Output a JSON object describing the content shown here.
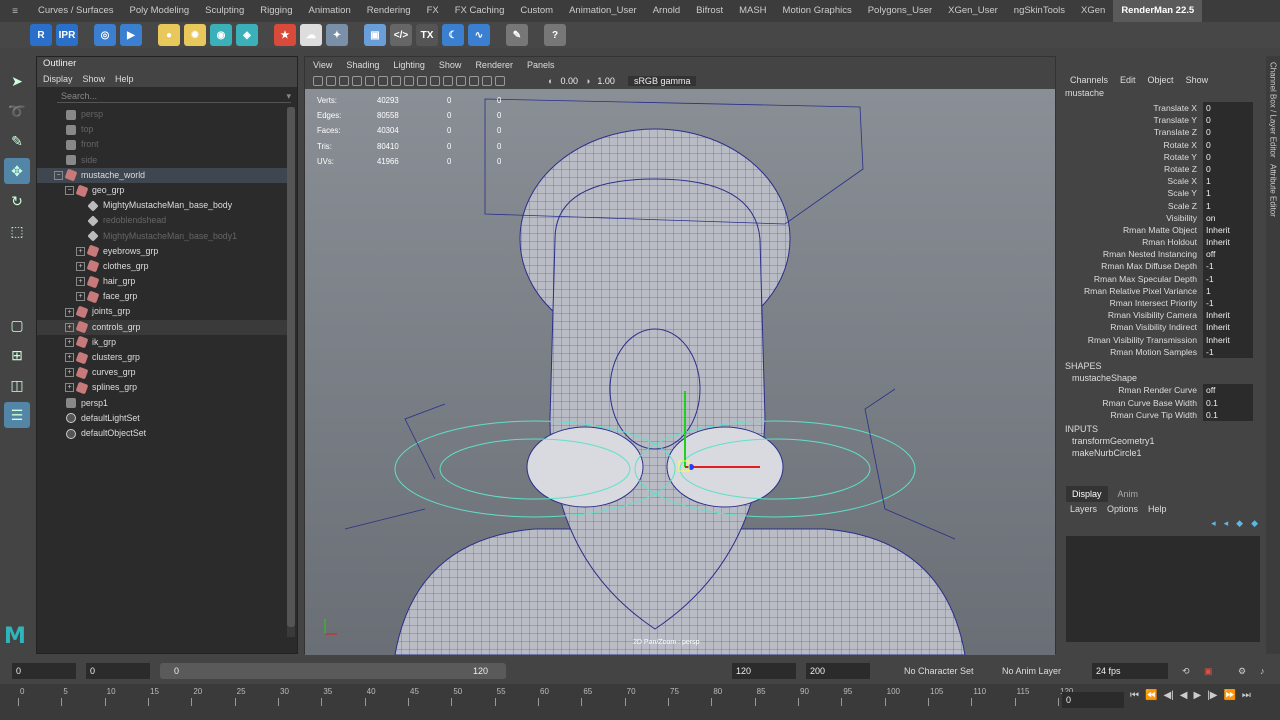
{
  "shelf": {
    "tabs": [
      "Curves / Surfaces",
      "Poly Modeling",
      "Sculpting",
      "Rigging",
      "Animation",
      "Rendering",
      "FX",
      "FX Caching",
      "Custom",
      "Animation_User",
      "Arnold",
      "Bifrost",
      "MASH",
      "Motion Graphics",
      "Polygons_User",
      "XGen_User",
      "ngSkinTools",
      "XGen",
      "RenderMan 22.5"
    ],
    "active_tab": "RenderMan 22.5",
    "icons": [
      {
        "name": "renderman-render-icon",
        "glyph": "R",
        "color": "#2a6fc9"
      },
      {
        "name": "renderman-ipr-icon",
        "glyph": "IPR",
        "color": "#2a6fc9"
      },
      {
        "name": "clapper-icon",
        "glyph": "◎",
        "color": "#3a7fd0"
      },
      {
        "name": "render-view-icon",
        "glyph": "▶",
        "color": "#3a7fd0"
      },
      {
        "name": "env-light-icon",
        "glyph": "●",
        "color": "#e8c85a"
      },
      {
        "name": "sun-light-icon",
        "glyph": "✹",
        "color": "#e8c85a"
      },
      {
        "name": "dome-light-icon",
        "glyph": "◉",
        "color": "#3bb0b8"
      },
      {
        "name": "light-filter-icon",
        "glyph": "◈",
        "color": "#3bb0b8"
      },
      {
        "name": "pixar-material-icon",
        "glyph": "★",
        "color": "#d84a3a"
      },
      {
        "name": "cloud-icon",
        "glyph": "☁",
        "color": "#dddddd"
      },
      {
        "name": "gear-star-icon",
        "glyph": "✦",
        "color": "#7a8fa8"
      },
      {
        "name": "cube-icon",
        "glyph": "▣",
        "color": "#6a9ed8"
      },
      {
        "name": "code-icon",
        "glyph": "</>",
        "color": "#666666"
      },
      {
        "name": "txmanager-icon",
        "glyph": "TX",
        "color": "#555555"
      },
      {
        "name": "moon-icon",
        "glyph": "☾",
        "color": "#3a7fd0"
      },
      {
        "name": "waveform-icon",
        "glyph": "∿",
        "color": "#3a7fd0"
      },
      {
        "name": "tools-icon",
        "glyph": "✎",
        "color": "#777777"
      },
      {
        "name": "help-icon",
        "glyph": "?",
        "color": "#777777"
      }
    ]
  },
  "outliner": {
    "title": "Outliner",
    "menu": [
      "Display",
      "Show",
      "Help"
    ],
    "search_placeholder": "Search...",
    "items": [
      {
        "label": "persp",
        "indent": 1,
        "icon": "cam",
        "dim": true
      },
      {
        "label": "top",
        "indent": 1,
        "icon": "cam",
        "dim": true
      },
      {
        "label": "front",
        "indent": 1,
        "icon": "cam",
        "dim": true
      },
      {
        "label": "side",
        "indent": 1,
        "icon": "cam",
        "dim": true
      },
      {
        "label": "mustache_world",
        "indent": 1,
        "icon": "grp",
        "exp": "−",
        "sel": true
      },
      {
        "label": "geo_grp",
        "indent": 2,
        "icon": "grp",
        "exp": "−"
      },
      {
        "label": "MightyMustacheMan_base_body",
        "indent": 3,
        "icon": "mesh"
      },
      {
        "label": "redoblendshead",
        "indent": 3,
        "icon": "mesh",
        "dim": true
      },
      {
        "label": "MightyMustacheMan_base_body1",
        "indent": 3,
        "icon": "mesh",
        "dim": true
      },
      {
        "label": "eyebrows_grp",
        "indent": 3,
        "icon": "grp",
        "exp": "+"
      },
      {
        "label": "clothes_grp",
        "indent": 3,
        "icon": "grp",
        "exp": "+"
      },
      {
        "label": "hair_grp",
        "indent": 3,
        "icon": "grp",
        "exp": "+"
      },
      {
        "label": "face_grp",
        "indent": 3,
        "icon": "grp",
        "exp": "+"
      },
      {
        "label": "joints_grp",
        "indent": 2,
        "icon": "grp",
        "exp": "+"
      },
      {
        "label": "controls_grp",
        "indent": 2,
        "icon": "grp",
        "exp": "+",
        "hl": true
      },
      {
        "label": "ik_grp",
        "indent": 2,
        "icon": "grp",
        "exp": "+"
      },
      {
        "label": "clusters_grp",
        "indent": 2,
        "icon": "grp",
        "exp": "+"
      },
      {
        "label": "curves_grp",
        "indent": 2,
        "icon": "grp",
        "exp": "+"
      },
      {
        "label": "splines_grp",
        "indent": 2,
        "icon": "grp",
        "exp": "+"
      },
      {
        "label": "persp1",
        "indent": 1,
        "icon": "cam"
      },
      {
        "label": "defaultLightSet",
        "indent": 1,
        "icon": "set"
      },
      {
        "label": "defaultObjectSet",
        "indent": 1,
        "icon": "set"
      }
    ]
  },
  "viewport": {
    "menu": [
      "View",
      "Shading",
      "Lighting",
      "Show",
      "Renderer",
      "Panels"
    ],
    "exposure": "0.00",
    "gamma": "1.00",
    "color_space": "sRGB gamma",
    "hud": [
      {
        "label": "Verts:",
        "v1": "40293",
        "v2": "0",
        "v3": "0"
      },
      {
        "label": "Edges:",
        "v1": "80558",
        "v2": "0",
        "v3": "0"
      },
      {
        "label": "Faces:",
        "v1": "40304",
        "v2": "0",
        "v3": "0"
      },
      {
        "label": "Tris:",
        "v1": "80410",
        "v2": "0",
        "v3": "0"
      },
      {
        "label": "UVs:",
        "v1": "41966",
        "v2": "0",
        "v3": "0"
      }
    ],
    "camera_label": "2D Pan/Zoom : persp"
  },
  "channel_box": {
    "menu": [
      "Channels",
      "Edit",
      "Object",
      "Show"
    ],
    "node": "mustache",
    "attributes": [
      {
        "name": "Translate X",
        "value": "0"
      },
      {
        "name": "Translate Y",
        "value": "0"
      },
      {
        "name": "Translate Z",
        "value": "0"
      },
      {
        "name": "Rotate X",
        "value": "0"
      },
      {
        "name": "Rotate Y",
        "value": "0"
      },
      {
        "name": "Rotate Z",
        "value": "0"
      },
      {
        "name": "Scale X",
        "value": "1"
      },
      {
        "name": "Scale Y",
        "value": "1"
      },
      {
        "name": "Scale Z",
        "value": "1"
      },
      {
        "name": "Visibility",
        "value": "on"
      },
      {
        "name": "Rman Matte Object",
        "value": "Inherit"
      },
      {
        "name": "Rman Holdout",
        "value": "Inherit"
      },
      {
        "name": "Rman Nested Instancing",
        "value": "off"
      },
      {
        "name": "Rman Max Diffuse Depth",
        "value": "-1"
      },
      {
        "name": "Rman Max Specular Depth",
        "value": "-1"
      },
      {
        "name": "Rman Relative Pixel Variance",
        "value": "1"
      },
      {
        "name": "Rman Intersect Priority",
        "value": "-1"
      },
      {
        "name": "Rman Visibility Camera",
        "value": "Inherit"
      },
      {
        "name": "Rman Visibility Indirect",
        "value": "Inherit"
      },
      {
        "name": "Rman Visibility Transmission",
        "value": "Inherit"
      },
      {
        "name": "Rman Motion Samples",
        "value": "-1"
      }
    ],
    "shapes_label": "SHAPES",
    "shape_node": "mustacheShape",
    "shape_attributes": [
      {
        "name": "Rman Render Curve",
        "value": "off"
      },
      {
        "name": "Rman Curve Base Width",
        "value": "0.1"
      },
      {
        "name": "Rman Curve Tip Width",
        "value": "0.1"
      }
    ],
    "inputs_label": "INPUTS",
    "inputs": [
      "transformGeometry1",
      "makeNurbCircle1"
    ]
  },
  "layer_editor": {
    "tabs": [
      "Display",
      "Anim"
    ],
    "menu": [
      "Layers",
      "Options",
      "Help"
    ]
  },
  "side_tabs": [
    "Channel Box / Layer Editor",
    "Attribute Editor"
  ],
  "time": {
    "start": "0",
    "playback_start": "0",
    "range_start": "0",
    "range_end": "120",
    "playback_end": "120",
    "end": "200",
    "character_set": "No Character Set",
    "anim_layer": "No Anim Layer",
    "fps": "24 fps",
    "current_frame": "0",
    "ticks": [
      "0",
      "5",
      "10",
      "15",
      "20",
      "25",
      "30",
      "35",
      "40",
      "45",
      "50",
      "55",
      "60",
      "65",
      "70",
      "75",
      "80",
      "85",
      "90",
      "95",
      "100",
      "105",
      "110",
      "115",
      "120"
    ]
  }
}
